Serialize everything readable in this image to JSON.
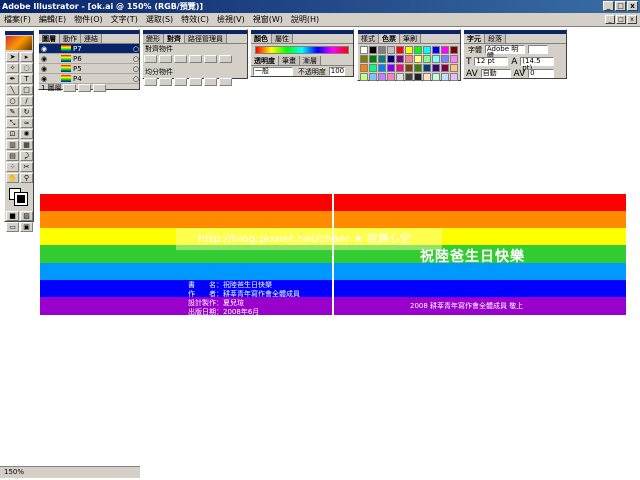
{
  "window": {
    "title": "Adobe Illustrator - [ok.ai @ 150% (RGB/預覽)]",
    "controls": [
      "_",
      "□",
      "x"
    ]
  },
  "menu": [
    "檔案(F)",
    "編輯(E)",
    "物件(O)",
    "文字(T)",
    "選取(S)",
    "特效(C)",
    "檢視(V)",
    "視窗(W)",
    "說明(H)"
  ],
  "layers_panel": {
    "tabs": [
      "圖層",
      "動作",
      "連結"
    ],
    "layers": [
      "P7",
      "P6",
      "P5",
      "P4"
    ],
    "selected_index": 0,
    "footer": "1 圖層"
  },
  "align_panel": {
    "tabs": [
      "變形",
      "對齊",
      "路徑管理員"
    ],
    "section1": "對齊物件",
    "section2": "均分物件"
  },
  "color_panel": {
    "tabs": [
      "顏色",
      "屬性"
    ],
    "tabs2": [
      "透明度",
      "筆畫",
      "漸層"
    ],
    "mode": "一般",
    "opacity_label": "不透明度",
    "opacity": "100"
  },
  "swatches_panel": {
    "tabs": [
      "樣式",
      "色票",
      "筆刷"
    ],
    "colors": [
      "#ffffff",
      "#000000",
      "#808080",
      "#c0c0c0",
      "#ff0000",
      "#ffff00",
      "#00ff00",
      "#00ffff",
      "#0000ff",
      "#ff00ff",
      "#800000",
      "#808000",
      "#008000",
      "#008080",
      "#000080",
      "#800080",
      "#ff8080",
      "#ffff80",
      "#80ff80",
      "#80ffff",
      "#8080ff",
      "#ff80ff",
      "#ff8000",
      "#00ff80",
      "#0080ff",
      "#8000ff",
      "#ff0080",
      "#804000",
      "#408000",
      "#004080",
      "#400080",
      "#800040",
      "#ffc080",
      "#c0ff80",
      "#80c0ff",
      "#c080ff",
      "#ff80c0",
      "#e0e0e0",
      "#404040",
      "#202020",
      "#ffe0c0",
      "#c0ffe0",
      "#c0e0ff",
      "#e0c0ff"
    ]
  },
  "char_panel": {
    "tabs": [
      "字元",
      "段落"
    ],
    "font_label": "字體",
    "font": "Adobe 明體",
    "size": "12 pt",
    "leading": "(14.5 pt)",
    "kerning": "自動",
    "tracking": "0"
  },
  "artwork": {
    "stripe_colors": [
      "#ff0000",
      "#ff8c00",
      "#ffff00",
      "#33cc33",
      "#0099ff",
      "#0000ff",
      "#9900cc"
    ],
    "back_lines": [
      "書　　名：祝陸爸生日快樂",
      "作　　者：耕莘青年寫作會全體成員",
      "設計製作：夏兒瑄",
      "出版日期：2008年6月"
    ],
    "front_title": "祝陸爸生日快樂",
    "front_sub": "2008 耕莘青年寫作會全體成員 敬上",
    "watermark": "http://blog.pixnet.net/chaer ★ 夜舞心空"
  },
  "statusbar": {
    "zoom": "150%"
  }
}
